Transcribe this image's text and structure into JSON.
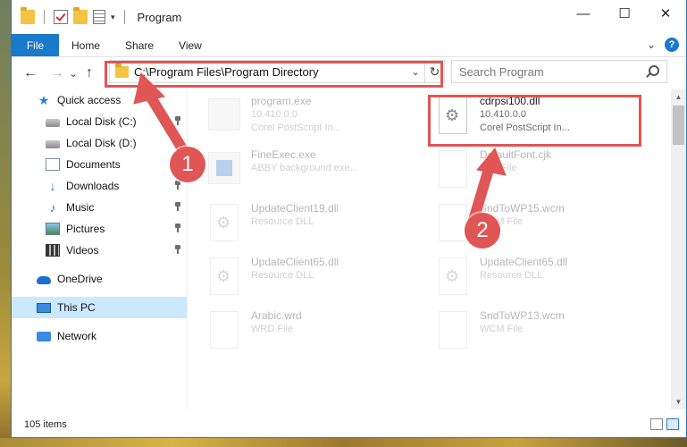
{
  "window": {
    "title": "Program",
    "controls": {
      "minimize": "—",
      "maximize": "☐",
      "close": "✕"
    }
  },
  "ribbon": {
    "file_label": "File",
    "tabs": [
      "Home",
      "Share",
      "View"
    ],
    "expand_glyph": "⌄",
    "help_glyph": "?"
  },
  "address": {
    "path": "C:\\Program Files\\Program Directory",
    "chevron": "⌄",
    "refresh": "↻"
  },
  "nav_buttons": {
    "back": "←",
    "forward": "→",
    "recent": "⌄",
    "up": "↑"
  },
  "search": {
    "placeholder": "Search Program"
  },
  "sidebar": {
    "items": [
      {
        "label": "Quick access",
        "icon": "star-icon",
        "pinned": false
      },
      {
        "label": "Local Disk (C:)",
        "icon": "disk-icon",
        "pinned": true
      },
      {
        "label": "Local Disk (D:)",
        "icon": "disk-icon",
        "pinned": false
      },
      {
        "label": "Documents",
        "icon": "documents-icon",
        "pinned": true
      },
      {
        "label": "Downloads",
        "icon": "downloads-icon",
        "pinned": true
      },
      {
        "label": "Music",
        "icon": "music-icon",
        "pinned": true
      },
      {
        "label": "Pictures",
        "icon": "pictures-icon",
        "pinned": true
      },
      {
        "label": "Videos",
        "icon": "videos-icon",
        "pinned": true
      },
      {
        "label": "OneDrive",
        "icon": "onedrive-icon",
        "pinned": false
      },
      {
        "label": "This PC",
        "icon": "this-pc-icon",
        "pinned": false,
        "selected": true
      },
      {
        "label": "Network",
        "icon": "network-icon",
        "pinned": false
      }
    ]
  },
  "files": [
    {
      "name": "program.exe",
      "line2": "10.410.0.0",
      "line3": "Corel PostScript In...",
      "icon": "exe-icon",
      "highlighted": false
    },
    {
      "name": "cdrpsi100.dll",
      "line2": "10.410.0.0",
      "line3": "Corel PostScript In...",
      "icon": "dll-gear-icon",
      "highlighted": true
    },
    {
      "name": "FineExec.exe",
      "line2": "ABBY background exe...",
      "line3": "",
      "icon": "exe-blue-icon",
      "highlighted": false
    },
    {
      "name": "DefaultFont.cjk",
      "line2": "CJK File",
      "line3": "",
      "icon": "doc-icon",
      "highlighted": false
    },
    {
      "name": "UpdateClient19.dll",
      "line2": "Resource DLL",
      "line3": "",
      "icon": "dll-gear-icon",
      "highlighted": false
    },
    {
      "name": "SndToWP15.wcm",
      "line2": "WCM File",
      "line3": "",
      "icon": "doc-icon",
      "highlighted": false
    },
    {
      "name": "UpdateClient65.dll",
      "line2": "Resource DLL",
      "line3": "",
      "icon": "dll-gear-icon",
      "highlighted": false
    },
    {
      "name": "UpdateClient65.dll",
      "line2": "Resource DLL",
      "line3": "",
      "icon": "dll-gear-icon",
      "highlighted": false
    },
    {
      "name": "Arabic.wrd",
      "line2": "WRD File",
      "line3": "",
      "icon": "doc-icon",
      "highlighted": false
    },
    {
      "name": "SndToWP13.wcm",
      "line2": "WCM File",
      "line3": "",
      "icon": "doc-icon",
      "highlighted": false
    }
  ],
  "status": {
    "item_count": "105 items"
  },
  "annotations": {
    "step1": "1",
    "step2": "2"
  },
  "colors": {
    "accent": "#1979ca",
    "highlight": "#e05555",
    "selected_bg": "#cce8ff"
  }
}
